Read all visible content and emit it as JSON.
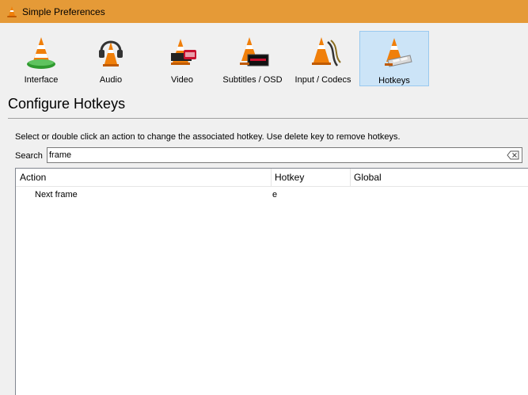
{
  "window": {
    "title": "Simple Preferences"
  },
  "categories": [
    {
      "label": "Interface",
      "icon": "vlc-cone-interface-icon",
      "selected": false
    },
    {
      "label": "Audio",
      "icon": "vlc-cone-headphones-icon",
      "selected": false
    },
    {
      "label": "Video",
      "icon": "vlc-cone-film-icon",
      "selected": false
    },
    {
      "label": "Subtitles / OSD",
      "icon": "vlc-cone-subtitles-icon",
      "selected": false
    },
    {
      "label": "Input / Codecs",
      "icon": "vlc-cone-cables-icon",
      "selected": false
    },
    {
      "label": "Hotkeys",
      "icon": "vlc-cone-keyboard-icon",
      "selected": true
    }
  ],
  "page": {
    "heading": "Configure Hotkeys",
    "help": "Select or double click an action to change the associated hotkey. Use delete key to remove hotkeys."
  },
  "search": {
    "label": "Search",
    "value": "frame"
  },
  "table": {
    "columns": [
      "Action",
      "Hotkey",
      "Global"
    ],
    "rows": [
      {
        "action": "Next frame",
        "hotkey": "e",
        "global": ""
      }
    ]
  },
  "colors": {
    "titlebar": "#e59a37",
    "selection": "#cce4f7",
    "selection_border": "#99c9ef",
    "cone_orange": "#f07f0a"
  }
}
